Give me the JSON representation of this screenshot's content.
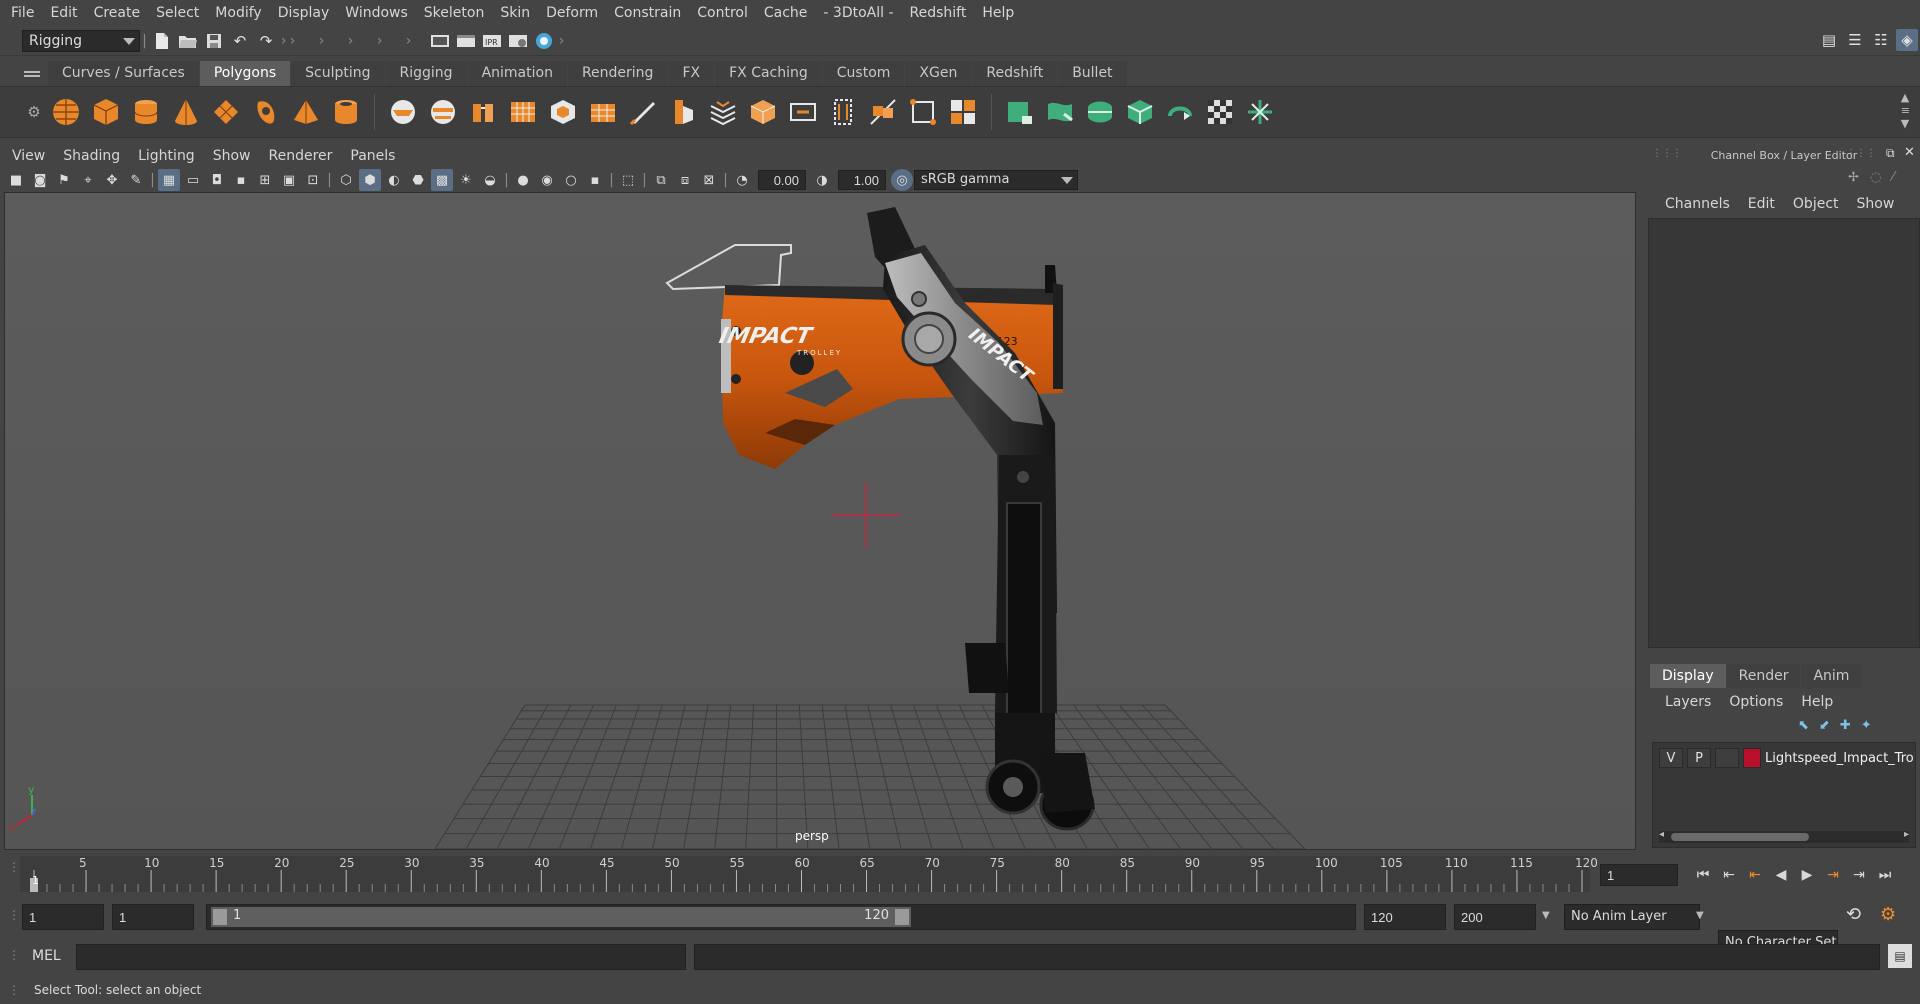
{
  "menubar": [
    "File",
    "Edit",
    "Create",
    "Select",
    "Modify",
    "Display",
    "Windows",
    "Skeleton",
    "Skin",
    "Deform",
    "Constrain",
    "Control",
    "Cache",
    "- 3DtoAll -",
    "Redshift",
    "Help"
  ],
  "statusline": {
    "mode": "Rigging"
  },
  "shelf_tabs": [
    "Curves / Surfaces",
    "Polygons",
    "Sculpting",
    "Rigging",
    "Animation",
    "Rendering",
    "FX",
    "FX Caching",
    "Custom",
    "XGen",
    "Redshift",
    "Bullet"
  ],
  "viewport": {
    "menu": [
      "View",
      "Shading",
      "Lighting",
      "Show",
      "Renderer",
      "Panels"
    ],
    "exposure": "0.00",
    "gamma": "1.00",
    "color_space": "sRGB gamma",
    "camera_label": "persp",
    "axis_y": "y",
    "axis_x": "x",
    "model_brand": "IMPACT",
    "model_sub": "TROLLEY",
    "model_cert": "CE0123",
    "colors": {
      "body_orange": "#c8560e",
      "arm_dark": "#2a2a2a",
      "arm_silver": "#9a9a9a"
    }
  },
  "channel_box": {
    "title": "Channel Box / Layer Editor",
    "menu": [
      "Channels",
      "Edit",
      "Object",
      "Show"
    ]
  },
  "layer_editor": {
    "tabs": [
      "Display",
      "Render",
      "Anim"
    ],
    "menu": [
      "Layers",
      "Options",
      "Help"
    ],
    "layer": {
      "v": "V",
      "p": "P",
      "name": "Lightspeed_Impact_Trolley",
      "color": "#b8102a"
    }
  },
  "timeline": {
    "ticks": [
      "1",
      "5",
      "10",
      "15",
      "20",
      "25",
      "30",
      "35",
      "40",
      "45",
      "50",
      "55",
      "60",
      "65",
      "70",
      "75",
      "80",
      "85",
      "90",
      "95",
      "100",
      "105",
      "110",
      "115",
      "120"
    ],
    "current_frame": "1"
  },
  "range": {
    "start": "1",
    "playback_start": "1",
    "slider_start": "1",
    "slider_end": "120",
    "playback_end": "120",
    "end": "200",
    "anim_layer": "No Anim Layer",
    "character_set": "No Character Set"
  },
  "command": {
    "lang": "MEL"
  },
  "help_line": "Select Tool: select an object"
}
